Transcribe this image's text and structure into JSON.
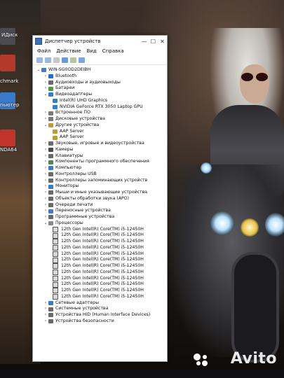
{
  "desktop": {
    "icons": [
      {
        "label": "ИДиск"
      },
      {
        "label": "chmark"
      },
      {
        "label": "пьютер"
      },
      {
        "label": "NDA64"
      }
    ],
    "watermark": "Avito"
  },
  "window": {
    "title": "Диспетчер устройств",
    "controls": {
      "minimize": "—",
      "maximize": "☐",
      "close": "✕"
    },
    "menu": [
      "Файл",
      "Действие",
      "Вид",
      "Справка"
    ]
  },
  "tree": {
    "root": "WIN-SG0OD2DEIBH",
    "categories": [
      {
        "label": "Bluetooth",
        "expanded": false,
        "color": "#1e6fd6"
      },
      {
        "label": "Аудиовходы и аудиовыходы",
        "expanded": false,
        "color": "#6a6a6a"
      },
      {
        "label": "Батареи",
        "expanded": false,
        "color": "#4d9a3d"
      },
      {
        "label": "Видеоадаптеры",
        "expanded": true,
        "color": "#2f7fd0",
        "children": [
          "Intel(R) UHD Graphics",
          "NVIDIA GeForce RTX 3050 Laptop GPU"
        ]
      },
      {
        "label": "Встроенное ПО",
        "expanded": false,
        "color": "#7a7a7a"
      },
      {
        "label": "Дисковые устройства",
        "expanded": false,
        "color": "#7a7a7a"
      },
      {
        "label": "Другие устройства",
        "expanded": true,
        "color": "#c59a2b",
        "children": [
          "AAP Server",
          "AAP Server"
        ]
      },
      {
        "label": "Звуковые, игровые и видеоустройства",
        "expanded": false,
        "color": "#6a6a6a"
      },
      {
        "label": "Камеры",
        "expanded": false,
        "color": "#4a4a4a"
      },
      {
        "label": "Клавиатуры",
        "expanded": false,
        "color": "#6a6a6a"
      },
      {
        "label": "Компоненты программного обеспечения",
        "expanded": false,
        "color": "#4d8a4d"
      },
      {
        "label": "Компьютер",
        "expanded": false,
        "color": "#3a7bd5"
      },
      {
        "label": "Контроллеры USB",
        "expanded": false,
        "color": "#6a6a6a"
      },
      {
        "label": "Контроллеры запоминающих устройств",
        "expanded": false,
        "color": "#6a6a6a"
      },
      {
        "label": "Мониторы",
        "expanded": false,
        "color": "#2f7fd0"
      },
      {
        "label": "Мыши и иные указывающие устройства",
        "expanded": false,
        "color": "#6a6a6a"
      },
      {
        "label": "Объекты обработки звука (APO)",
        "expanded": false,
        "color": "#6a6a6a"
      },
      {
        "label": "Очереди печати",
        "expanded": false,
        "color": "#6a6a6a"
      },
      {
        "label": "Переносные устройства",
        "expanded": false,
        "color": "#3a7bd5"
      },
      {
        "label": "Программные устройства",
        "expanded": false,
        "color": "#6a6a6a"
      },
      {
        "label": "Процессоры",
        "expanded": true,
        "color": "#8a8a8a",
        "children": [
          "12th Gen Intel(R) Core(TM) i5-12450H",
          "12th Gen Intel(R) Core(TM) i5-12450H",
          "12th Gen Intel(R) Core(TM) i5-12450H",
          "12th Gen Intel(R) Core(TM) i5-12450H",
          "12th Gen Intel(R) Core(TM) i5-12450H",
          "12th Gen Intel(R) Core(TM) i5-12450H",
          "12th Gen Intel(R) Core(TM) i5-12450H",
          "12th Gen Intel(R) Core(TM) i5-12450H",
          "12th Gen Intel(R) Core(TM) i5-12450H",
          "12th Gen Intel(R) Core(TM) i5-12450H",
          "12th Gen Intel(R) Core(TM) i5-12450H",
          "12th Gen Intel(R) Core(TM) i5-12450H"
        ]
      },
      {
        "label": "Сетевые адаптеры",
        "expanded": false,
        "color": "#2f7fd0"
      },
      {
        "label": "Системные устройства",
        "expanded": false,
        "color": "#6a6a6a"
      },
      {
        "label": "Устройства HID (Human Interface Devices)",
        "expanded": false,
        "color": "#6a6a6a"
      },
      {
        "label": "Устройства безопасности",
        "expanded": false,
        "color": "#6a6a6a"
      }
    ]
  }
}
